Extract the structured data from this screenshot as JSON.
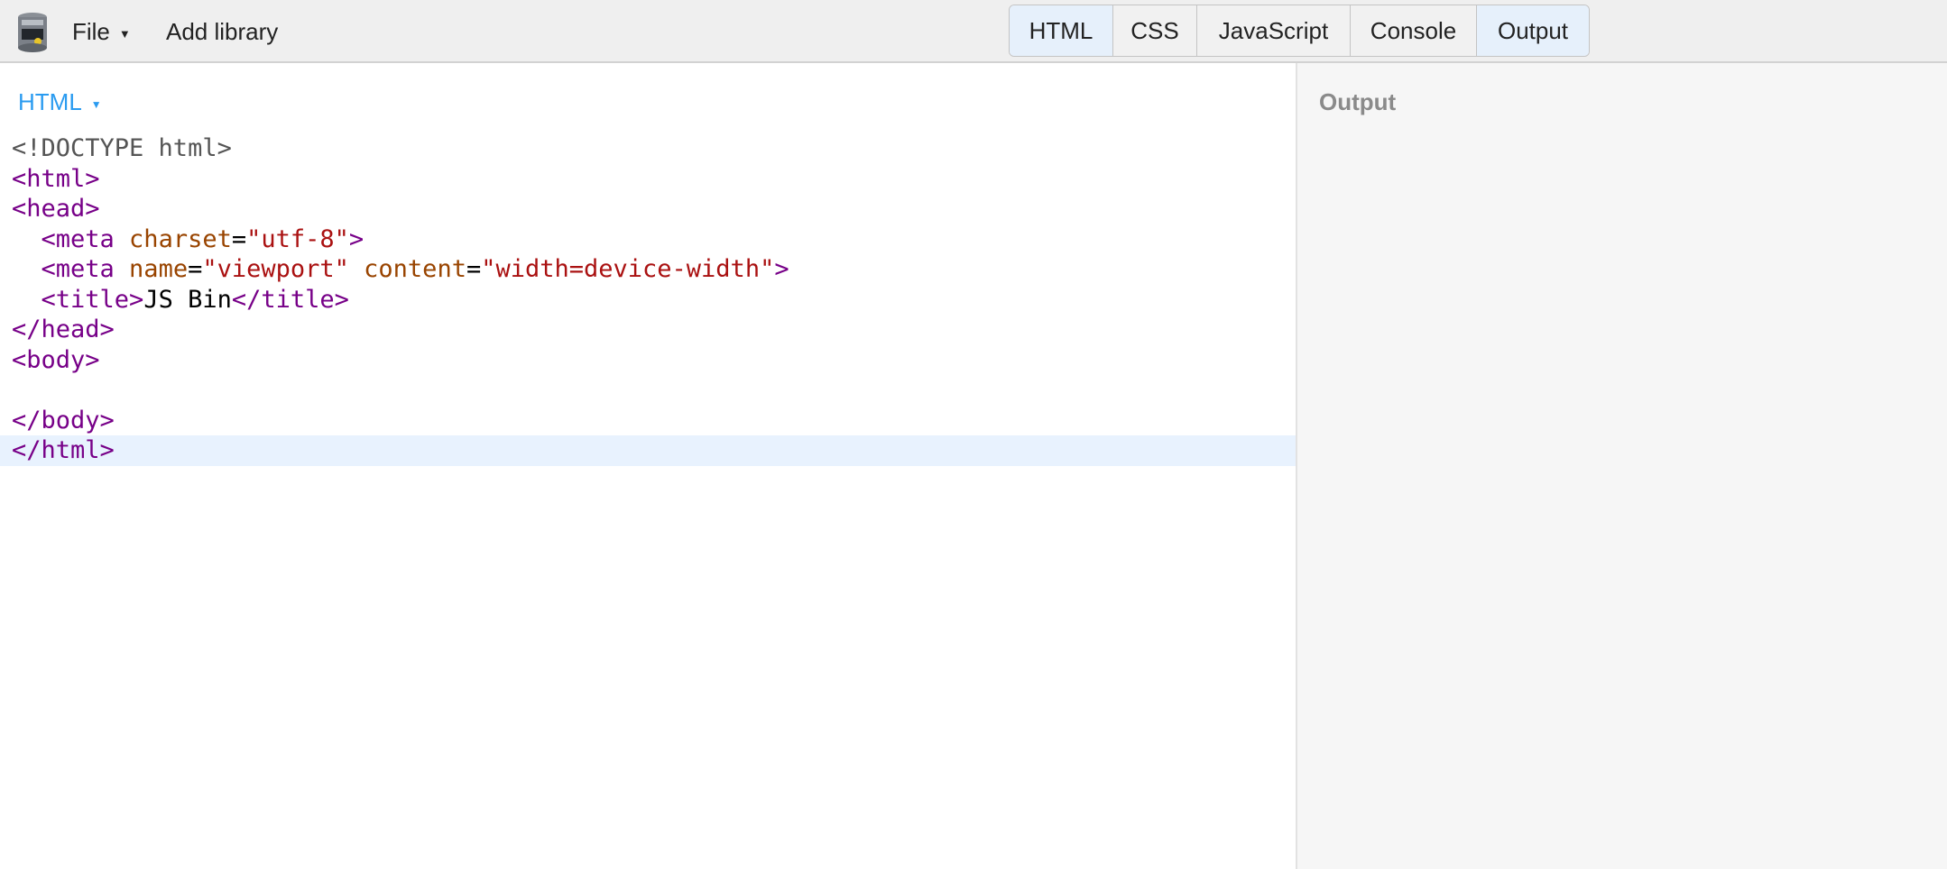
{
  "toolbar": {
    "logo_icon": "jsbin-logo-icon",
    "file_label": "File",
    "add_library_label": "Add library"
  },
  "panel_tabs": [
    {
      "label": "HTML",
      "active": true
    },
    {
      "label": "CSS",
      "active": false
    },
    {
      "label": "JavaScript",
      "active": false
    },
    {
      "label": "Console",
      "active": false
    },
    {
      "label": "Output",
      "active": true
    }
  ],
  "editor": {
    "mode_label": "HTML",
    "lines": [
      [
        "<!DOCTYPE html>"
      ],
      [
        "<html>"
      ],
      [
        "<head>"
      ],
      [
        "  <meta",
        " charset",
        "=",
        "\"utf-8\"",
        ">"
      ],
      [
        "  <meta",
        " name",
        "=",
        "\"viewport\"",
        " content",
        "=",
        "\"width=device-width\"",
        ">"
      ],
      [
        "  <title>",
        "JS Bin",
        "</title>"
      ],
      [
        "</head>"
      ],
      [
        "<body>"
      ],
      [
        ""
      ],
      [
        "</body>"
      ],
      [
        "</html>"
      ]
    ],
    "current_line": 11
  },
  "output": {
    "label": "Output"
  },
  "colors": {
    "accent": "#2a9bf0",
    "tag": "#770088",
    "attribute": "#994400",
    "string": "#aa1111",
    "doctype": "#555555",
    "active_tab_bg": "#e6f0fb",
    "current_line_bg": "#e8f2fe"
  }
}
